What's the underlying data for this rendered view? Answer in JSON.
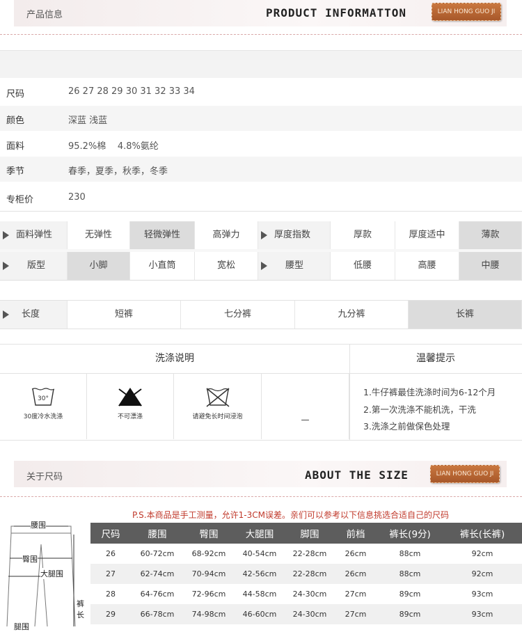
{
  "header1": {
    "cn": "产品信息",
    "en": "PRODUCT INFORMATTON",
    "tag": "LIAN HONG GUO JI"
  },
  "attributes": [
    {
      "key": "尺码",
      "value": "26 27 28 29 30 31 32 33 34"
    },
    {
      "key": "颜色",
      "value": "深蓝 浅蓝"
    },
    {
      "key": "面料",
      "value": "95.2%棉    4.8%氨纶"
    },
    {
      "key": "季节",
      "value": "春季，夏季，秋季，冬季"
    },
    {
      "key": "专柜价",
      "value": "230"
    }
  ],
  "options": {
    "elasticity": {
      "label": "面料弹性",
      "items": [
        "无弹性",
        "轻微弹性",
        "高弹力"
      ],
      "selected": 1
    },
    "thickness": {
      "label": "厚度指数",
      "items": [
        "厚款",
        "厚度适中",
        "薄款"
      ],
      "selected": 2
    },
    "fit": {
      "label": "版型",
      "items": [
        "小脚",
        "小直筒",
        "宽松"
      ],
      "selected": 0
    },
    "waist": {
      "label": "腰型",
      "items": [
        "低腰",
        "高腰",
        "中腰"
      ],
      "selected": 2
    },
    "length": {
      "label": "长度",
      "items": [
        "短裤",
        "七分裤",
        "九分裤",
        "长裤"
      ],
      "selected": 3
    }
  },
  "wash": {
    "title": "洗涤说明",
    "tips_title": "温馨提示",
    "items": [
      {
        "icon": "wash-30-icon",
        "label": "30度冷水洗涤",
        "temp": "30°"
      },
      {
        "icon": "no-bleach-icon",
        "label": "不可漂涤"
      },
      {
        "icon": "no-soak-icon",
        "label": "请避免长时间浸泡"
      },
      {
        "icon": "",
        "label": "—"
      }
    ],
    "tips": [
      "1.牛仔裤最佳洗涤时间为6-12个月",
      "2.第一次洗涤不能机洗，干洗",
      "3.洗涤之前做保色处理"
    ]
  },
  "header2": {
    "cn": "关于尺码",
    "en": "ABOUT THE SIZE",
    "tag": "LIAN HONG GUO JI"
  },
  "size_note": "P.S.本商品是手工测量，允许1-3CM误差。亲们可以参考以下信息挑选合适自己的尺码",
  "diagram": {
    "waist": "腰围",
    "hip": "臀围",
    "thigh": "大腿围",
    "length": "裤长",
    "leg": "腿围"
  },
  "size_table": {
    "headers": [
      "尺码",
      "腰围",
      "臀围",
      "大腿围",
      "脚围",
      "前档",
      "裤长(9分)",
      "裤长(长裤)"
    ],
    "rows": [
      [
        "26",
        "60-72cm",
        "68-92cm",
        "40-54cm",
        "22-28cm",
        "26cm",
        "88cm",
        "92cm"
      ],
      [
        "27",
        "62-74cm",
        "70-94cm",
        "42-56cm",
        "22-28cm",
        "26cm",
        "88cm",
        "92cm"
      ],
      [
        "28",
        "64-76cm",
        "72-96cm",
        "44-58cm",
        "24-30cm",
        "27cm",
        "89cm",
        "93cm"
      ],
      [
        "29",
        "66-78cm",
        "74-98cm",
        "46-60cm",
        "24-30cm",
        "27cm",
        "89cm",
        "93cm"
      ]
    ]
  }
}
